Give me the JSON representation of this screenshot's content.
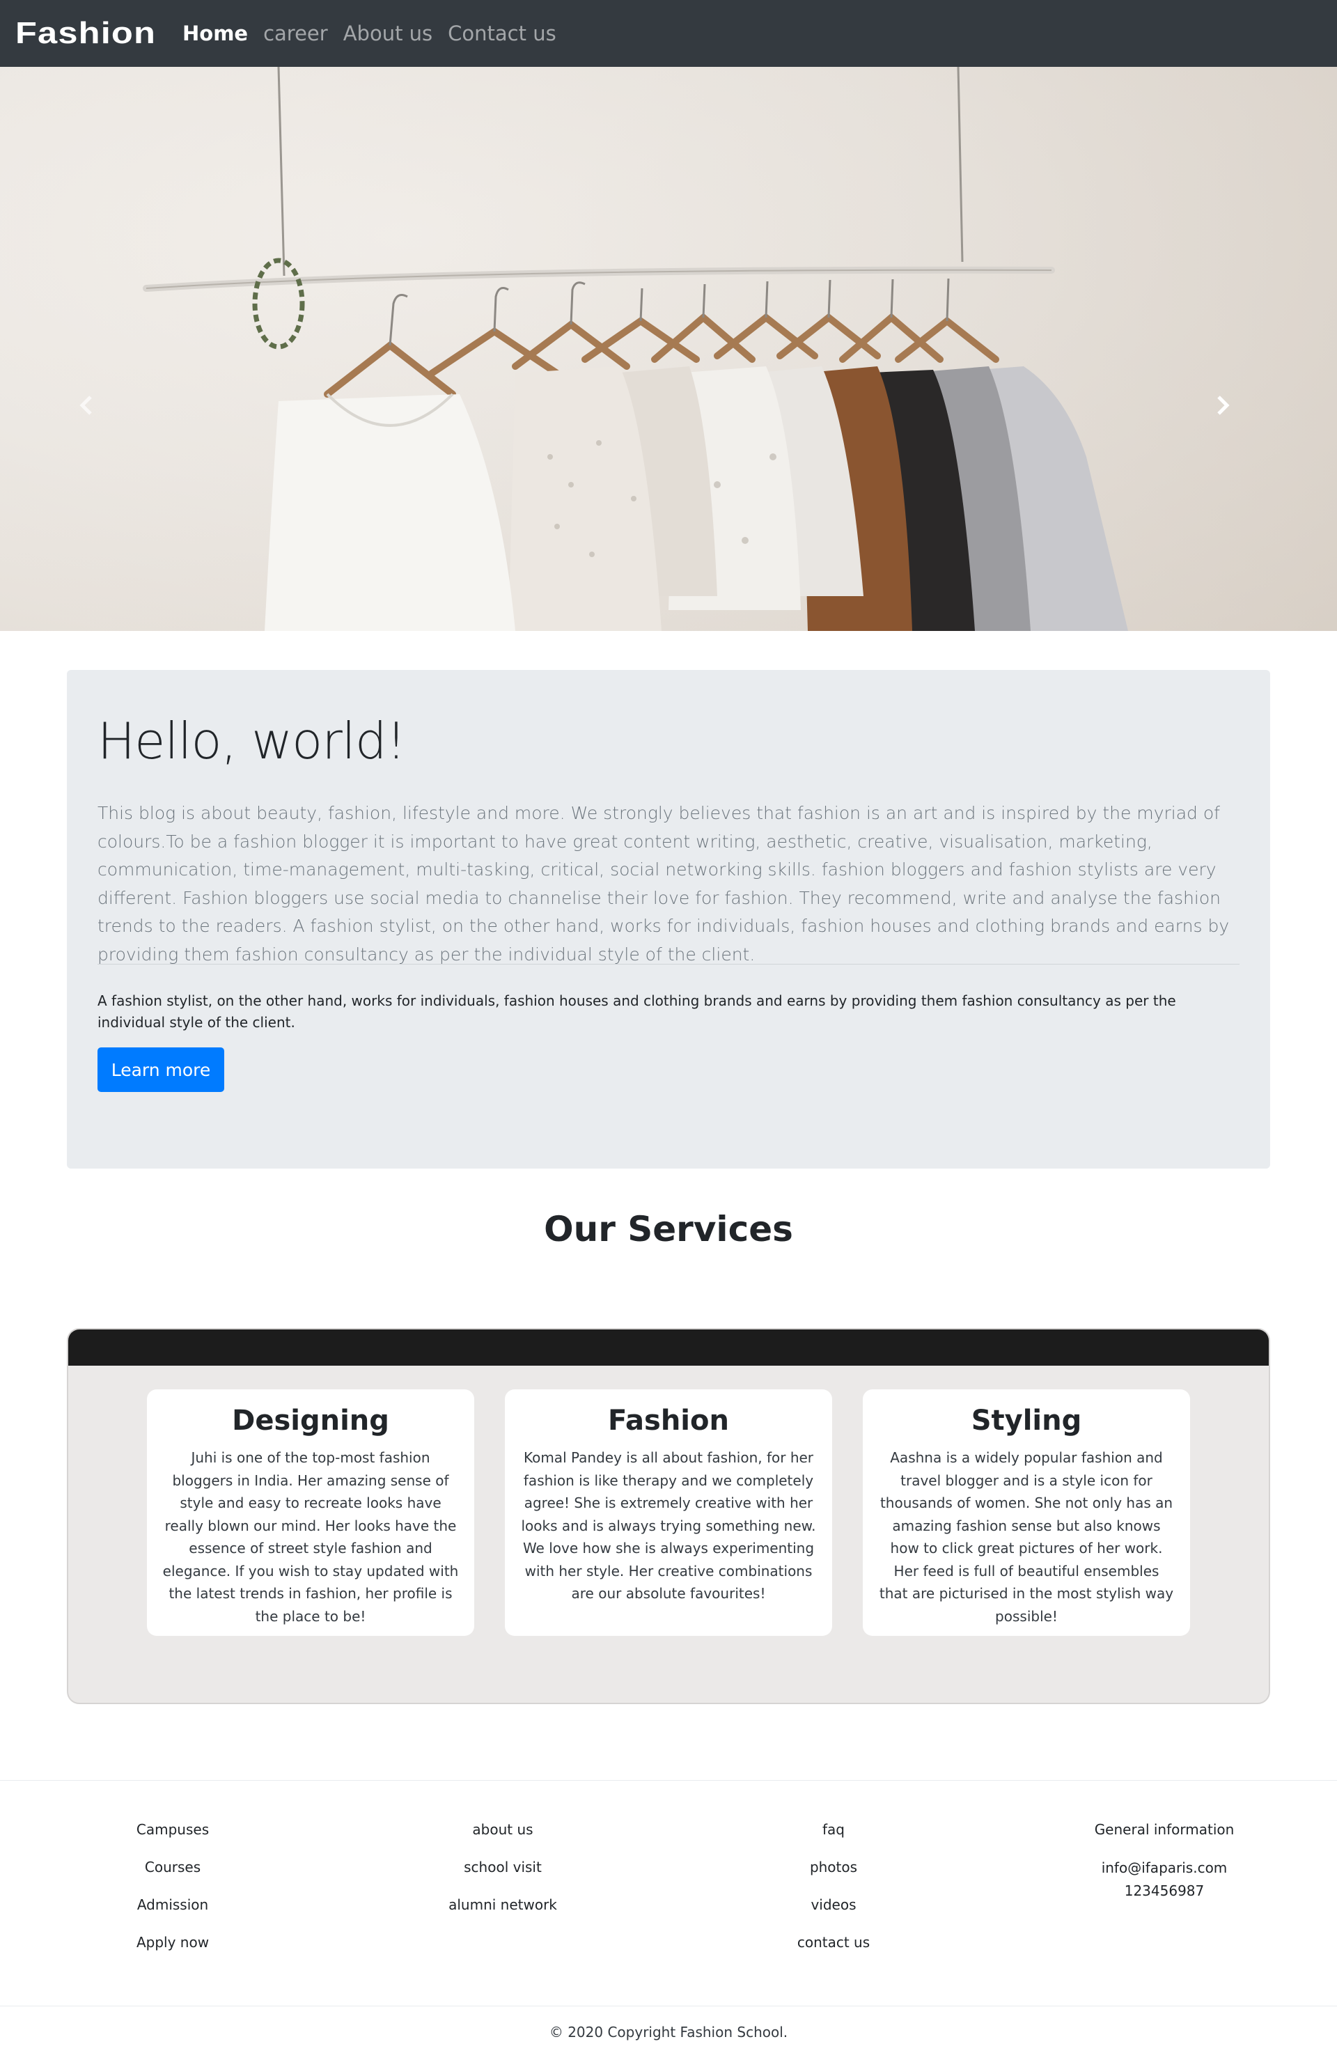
{
  "navbar": {
    "brand": "Fashion",
    "links": [
      "Home",
      "career",
      "About us",
      "Contact us"
    ]
  },
  "carousel": {
    "prev_icon": "chevron-left-icon",
    "next_icon": "chevron-right-icon",
    "slide_count": 3,
    "active_slide": 0
  },
  "jumbotron": {
    "title": "Hello, world!",
    "lead": "This blog is about beauty, fashion, lifestyle and more. We strongly believes that fashion is an art and is inspired by the myriad of colours.To be a fashion blogger it is important to have great content writing, aesthetic, creative, visualisation, marketing, communication, time-management, multi-tasking, critical, social networking skills. fashion bloggers and fashion stylists are very different. Fashion bloggers use social media to channelise their love for fashion. They recommend, write and analyse the fashion trends to the readers. A fashion stylist, on the other hand, works for individuals, fashion houses and clothing brands and earns by providing them fashion consultancy as per the individual style of the client.",
    "text": "A fashion stylist, on the other hand, works for individuals, fashion houses and clothing brands and earns by providing them fashion consultancy as per the individual style of the client.",
    "button": "Learn more"
  },
  "services": {
    "title": "Our Services",
    "cards": [
      {
        "title": "Designing",
        "text": "Juhi is one of the top-most fashion bloggers in India. Her amazing sense of style and easy to recreate looks have really blown our mind. Her looks have the essence of street style fashion and elegance. If you wish to stay updated with the latest trends in fashion, her profile is the place to be!"
      },
      {
        "title": "Fashion",
        "text": "Komal Pandey is all about fashion, for her fashion is like therapy and we completely agree! She is extremely creative with her looks and is always trying something new. We love how she is always experimenting with her style. Her creative combinations are our absolute favourites!"
      },
      {
        "title": "Styling",
        "text": "Aashna is a widely popular fashion and travel blogger and is a style icon for thousands of women. She not only has an amazing fashion sense but also knows how to click great pictures of her work. Her feed is full of beautiful ensembles that are picturised in the most stylish way possible!"
      }
    ]
  },
  "footer": {
    "col1": [
      "Campuses",
      "Courses",
      "Admission",
      "Apply now"
    ],
    "col2": [
      "about us",
      "school visit",
      "alumni network"
    ],
    "col3": [
      "faq",
      "photos",
      "videos",
      "contact us"
    ],
    "col4": {
      "heading": "General information",
      "email": "info@ifaparis.com",
      "phone": "123456987"
    },
    "copyright": "© 2020 Copyright Fashion School."
  }
}
